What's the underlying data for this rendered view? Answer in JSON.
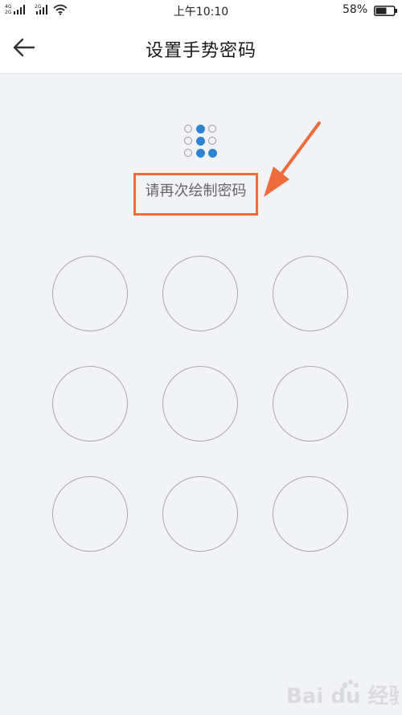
{
  "status_bar": {
    "net_a": "4G",
    "net_a2": "2G",
    "net_b": "2G",
    "time": "上午10:10",
    "battery": "58%"
  },
  "header": {
    "title": "设置手势密码"
  },
  "pattern_preview": {
    "states": [
      0,
      1,
      0,
      0,
      1,
      0,
      0,
      1,
      1
    ]
  },
  "hint": {
    "text": "请再次绘制密码"
  },
  "colors": {
    "accent_blue": "#2f84d2",
    "annotation_orange": "#ee6c3b",
    "background": "#f2f3f7"
  },
  "watermark": {
    "text": "Bai du 经验"
  }
}
